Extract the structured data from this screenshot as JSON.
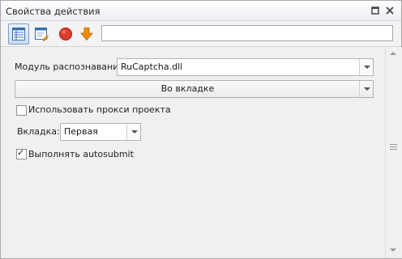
{
  "window": {
    "title": "Свойства действия"
  },
  "toolbar": {
    "icons": [
      "table-view-icon",
      "edit-form-icon",
      "record-icon",
      "download-arrow-icon"
    ],
    "input_value": ""
  },
  "form": {
    "recognition_module": {
      "label": "Модуль распознавания:",
      "value": "RuCaptcha.dll"
    },
    "location_select": {
      "value": "Во вкладке"
    },
    "use_proxy": {
      "label": "Использовать прокси проекта",
      "checked": false
    },
    "tab": {
      "label": "Вкладка:",
      "value": "Первая"
    },
    "autosubmit": {
      "label": "Выполнять autosubmit",
      "checked": true
    }
  },
  "colors": {
    "record_red": "#e03a2a",
    "arrow_orange": "#f08a00",
    "accent_blue": "#7c9ec9"
  }
}
